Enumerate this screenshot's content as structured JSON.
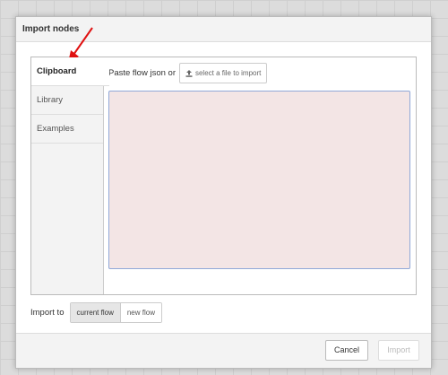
{
  "dialog": {
    "title": "Import nodes"
  },
  "tabs": [
    {
      "label": "Clipboard",
      "active": true
    },
    {
      "label": "Library",
      "active": false
    },
    {
      "label": "Examples",
      "active": false
    }
  ],
  "clipboard": {
    "paste_label": "Paste flow json or",
    "file_button_label": "select a file to import",
    "file_button_icon": "upload-icon",
    "textarea_value": "",
    "textarea_color": "#f3e5e5"
  },
  "import_to": {
    "label": "Import to",
    "options": [
      "current flow",
      "new flow"
    ],
    "selected": "current flow"
  },
  "footer": {
    "cancel_label": "Cancel",
    "import_label": "Import",
    "import_disabled": true
  },
  "annotation": {
    "arrow_color": "#e01010"
  }
}
